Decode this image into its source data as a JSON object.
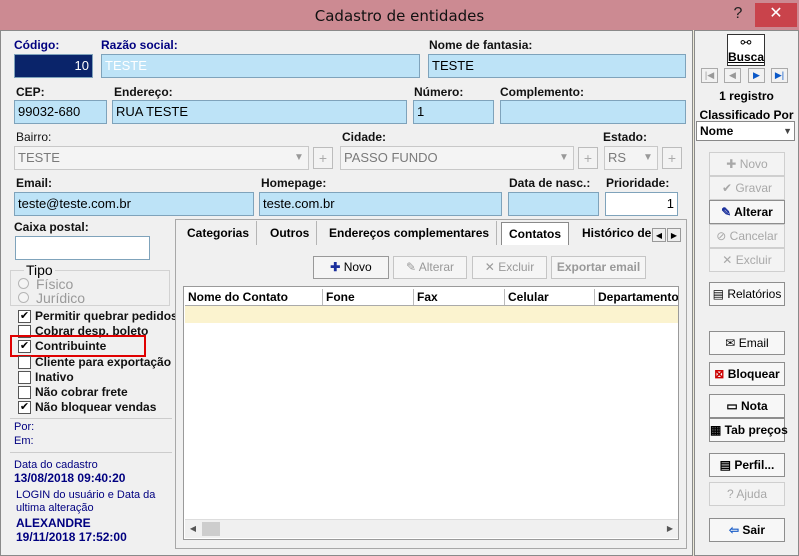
{
  "window": {
    "title": "Cadastro de entidades"
  },
  "form": {
    "codigo": {
      "label": "Código:",
      "value": "10"
    },
    "razao_social": {
      "label": "Razão social:",
      "value": "TESTE"
    },
    "nome_fantasia": {
      "label": "Nome de fantasia:",
      "value": "TESTE"
    },
    "cep": {
      "label": "CEP:",
      "value": "99032-680"
    },
    "endereco": {
      "label": "Endereço:",
      "value": "RUA TESTE"
    },
    "numero": {
      "label": "Número:",
      "value": "1"
    },
    "complemento": {
      "label": "Complemento:",
      "value": ""
    },
    "bairro": {
      "label": "Bairro:",
      "value": "TESTE"
    },
    "cidade": {
      "label": "Cidade:",
      "value": "PASSO FUNDO"
    },
    "estado": {
      "label": "Estado:",
      "value": "RS"
    },
    "email": {
      "label": "Email:",
      "value": "teste@teste.com.br"
    },
    "homepage": {
      "label": "Homepage:",
      "value": "teste.com.br"
    },
    "data_nasc": {
      "label": "Data de nasc.:",
      "value": ""
    },
    "prioridade": {
      "label": "Prioridade:",
      "value": "1"
    },
    "caixa_postal": {
      "label": "Caixa postal:",
      "value": ""
    }
  },
  "tipo": {
    "title": "Tipo",
    "options": [
      "Físico",
      "Jurídico"
    ]
  },
  "checkboxes": [
    {
      "label": "Permitir quebrar pedidos",
      "checked": true
    },
    {
      "label": "Cobrar desp. boleto",
      "checked": false
    },
    {
      "label": "Contribuinte",
      "checked": true
    },
    {
      "label": "Cliente para exportação",
      "checked": false
    },
    {
      "label": "Inativo",
      "checked": false
    },
    {
      "label": "Não cobrar frete",
      "checked": false
    },
    {
      "label": "Não bloquear vendas",
      "checked": true
    }
  ],
  "info": {
    "por": "Por:",
    "em": "Em:",
    "data_cadastro_label": "Data do cadastro",
    "data_cadastro_value": "13/08/2018 09:40:20",
    "login_label_1": "LOGIN do usuário e Data da",
    "login_label_2": "ultima alteração",
    "login_user": "ALEXANDRE",
    "login_date": "19/11/2018 17:52:00"
  },
  "tabs": [
    "Categorias",
    "Outros",
    "Endereços complementares",
    "Contatos",
    "Histórico de"
  ],
  "contacts": {
    "toolbar": {
      "novo": "Novo",
      "alterar": "Alterar",
      "excluir": "Excluir",
      "exportar": "Exportar email"
    },
    "columns": [
      "Nome do Contato",
      "Fone",
      "Fax",
      "Celular",
      "Departamento"
    ]
  },
  "right": {
    "busca": "Busca",
    "registro": "1 registro",
    "classificado_label": "Classificado Por",
    "classificado_value": "Nome",
    "buttons": {
      "novo": "Novo",
      "gravar": "Gravar",
      "alterar": "Alterar",
      "cancelar": "Cancelar",
      "excluir": "Excluir",
      "relatorios": "Relatórios",
      "email": "Email",
      "bloquear": "Bloquear",
      "nota": "Nota",
      "tab_precos": "Tab preços",
      "perfil": "Perfil...",
      "ajuda": "Ajuda",
      "sair": "Sair"
    }
  },
  "colors": {
    "field_bg": "#bde3f7",
    "titlebar": "#cc8a92",
    "highlight_box": "#e00000",
    "label_blue": "#000080"
  }
}
